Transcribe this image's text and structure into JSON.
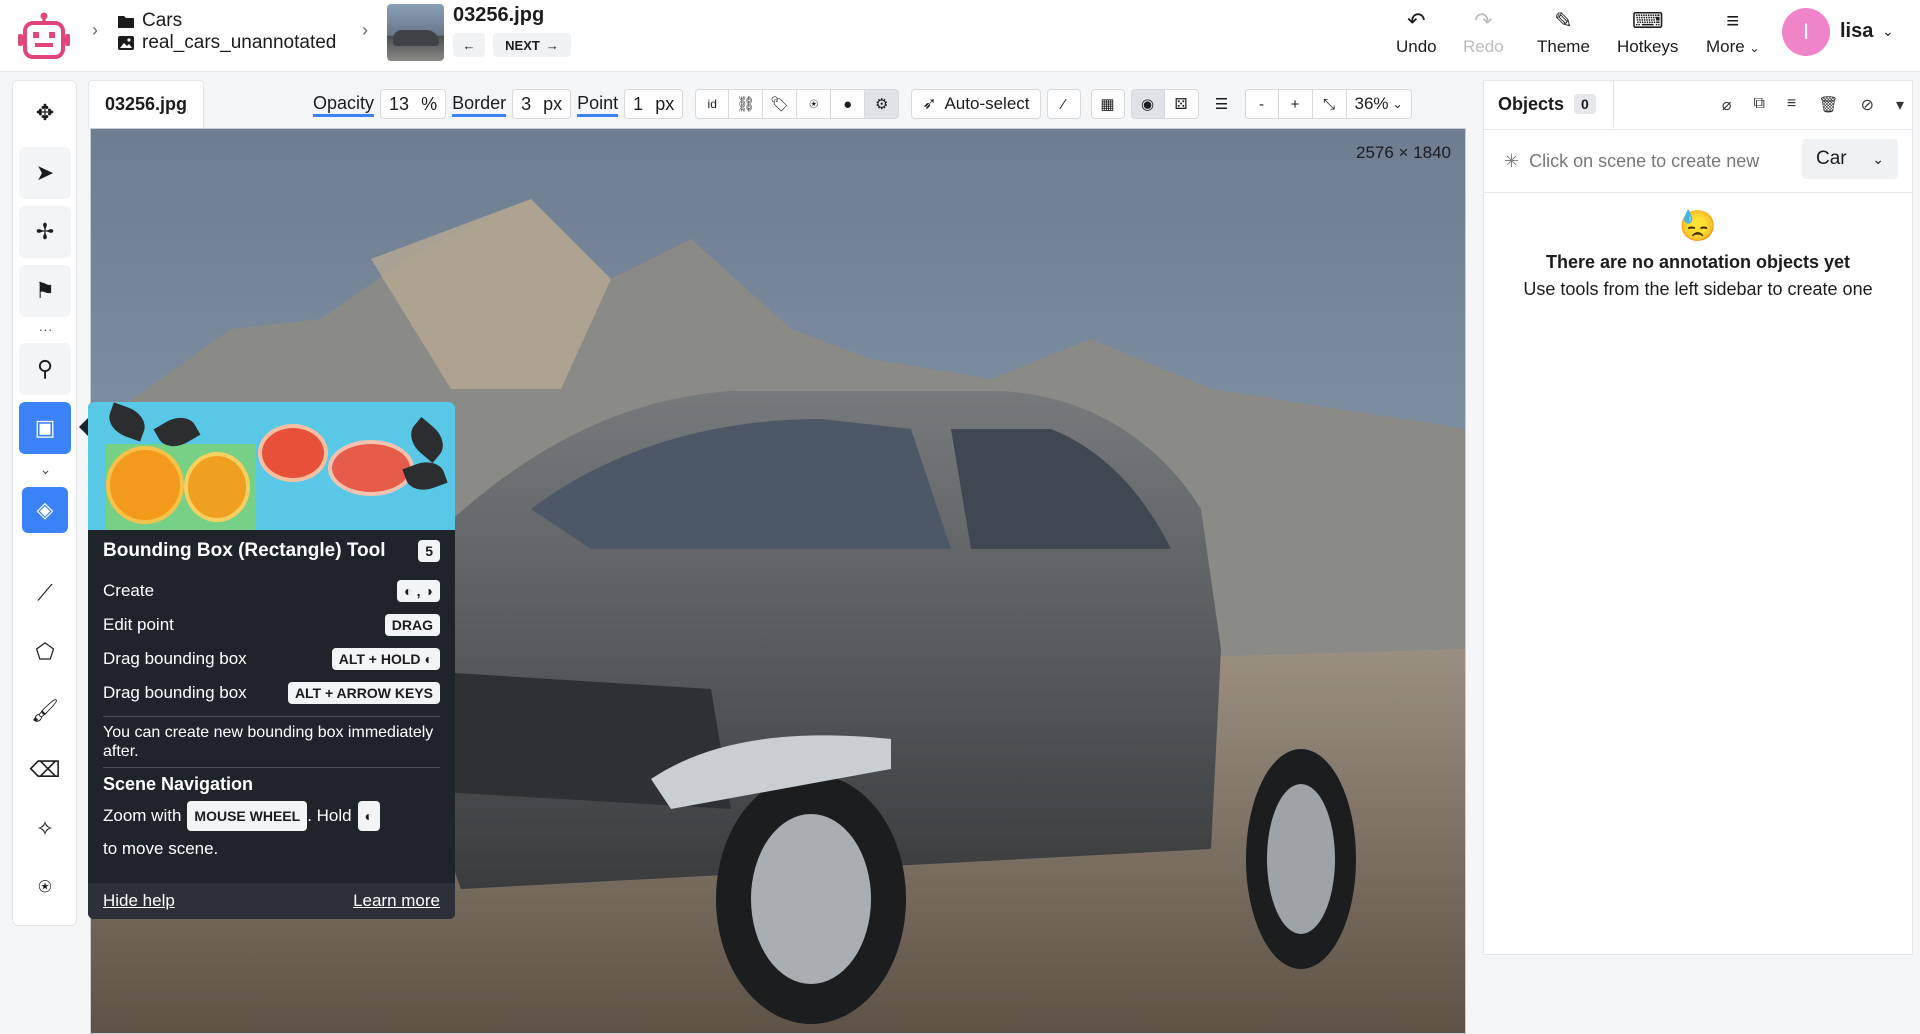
{
  "header": {
    "project_name": "Cars",
    "dataset_name": "real_cars_unannotated",
    "file_name": "03256.jpg",
    "prev_icon": "arrow-left-icon",
    "next_label": "NEXT",
    "undo_label": "Undo",
    "redo_label": "Redo",
    "theme_label": "Theme",
    "hotkeys_label": "Hotkeys",
    "more_label": "More",
    "user_initial": "I",
    "user_name": "lisa"
  },
  "left_toolbar": {
    "tools": [
      "move-tool",
      "select-tool",
      "pan-tool",
      "flag-tool",
      "keypoint-tool",
      "bounding-box-tool",
      "fill-tool",
      "polyline-tool",
      "polygon-tool",
      "brush-tool",
      "eraser-tool",
      "smart-tool",
      "graph-tool"
    ],
    "active_tool": "bounding-box-tool"
  },
  "canvas": {
    "tab_label": "03256.jpg",
    "opacity_label": "Opacity",
    "opacity_value": "13",
    "opacity_unit": "%",
    "border_label": "Border",
    "border_value": "3",
    "border_unit": "px",
    "point_label": "Point",
    "point_value": "1",
    "point_unit": "px",
    "id_label": "id",
    "auto_select_label": "Auto-select",
    "zoom_minus": "-",
    "zoom_plus": "+",
    "zoom_value": "36%",
    "image_dimensions": "2576 × 1840"
  },
  "tooltip": {
    "title": "Bounding Box (Rectangle) Tool",
    "hotkey": "5",
    "rows": [
      {
        "label": "Create",
        "key": "LMB, RMB"
      },
      {
        "label": "Edit point",
        "key": "DRAG"
      },
      {
        "label": "Drag bounding box",
        "key": "ALT + HOLD"
      },
      {
        "label": "Drag bounding box",
        "key": "ALT + ARROW KEYS"
      }
    ],
    "note": "You can create new bounding box immediately after.",
    "nav_title": "Scene Navigation",
    "nav_zoom_prefix": "Zoom with",
    "nav_zoom_key": "MOUSE WHEEL",
    "nav_hold": ". Hold",
    "nav_suffix": "to move scene.",
    "hide_help": "Hide help",
    "learn_more": "Learn more"
  },
  "objects_panel": {
    "tab_label": "Objects",
    "count": "0",
    "create_hint": "Click on scene to create new",
    "class_value": "Car",
    "empty_emoji": "😓",
    "empty_title": "There are no annotation objects yet",
    "empty_subtitle": "Use tools from the left sidebar to create one"
  },
  "colors": {
    "accent": "#3b82f6",
    "avatar": "#f084c8",
    "logo": "#e0467a"
  }
}
